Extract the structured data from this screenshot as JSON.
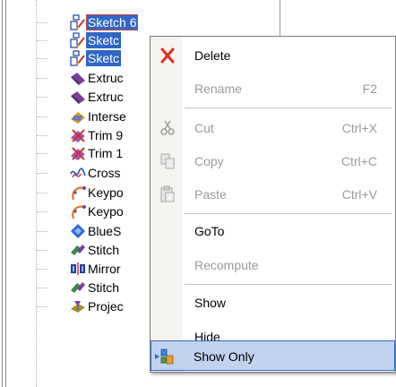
{
  "tree": {
    "items": [
      {
        "label": "Sketch 6",
        "icon": "sketch-icon",
        "selected": true
      },
      {
        "label": "Sketc",
        "icon": "sketch-icon",
        "selected": true
      },
      {
        "label": "Sketc",
        "icon": "sketch-icon",
        "selected": true
      },
      {
        "label": "Extruc",
        "icon": "extrude-icon"
      },
      {
        "label": "Extruc",
        "icon": "extrude-icon"
      },
      {
        "label": "Interse",
        "icon": "intersect-icon"
      },
      {
        "label": "Trim 9",
        "icon": "trim-icon"
      },
      {
        "label": "Trim 1",
        "icon": "trim-icon"
      },
      {
        "label": "Cross",
        "icon": "cross-section-icon"
      },
      {
        "label": "Keypo",
        "icon": "keypoint-curve-icon"
      },
      {
        "label": "Keypo",
        "icon": "keypoint-curve-icon"
      },
      {
        "label": "BlueS",
        "icon": "blue-surface-icon"
      },
      {
        "label": "Stitch",
        "icon": "stitch-icon"
      },
      {
        "label": "Mirror",
        "icon": "mirror-icon"
      },
      {
        "label": "Stitch",
        "icon": "stitch-icon"
      },
      {
        "label": "Projec",
        "icon": "project-icon"
      }
    ]
  },
  "context_menu": {
    "items": [
      {
        "label": "Delete",
        "shortcut": "",
        "icon": "delete-icon",
        "disabled": false
      },
      {
        "label": "Rename",
        "shortcut": "F2",
        "icon": "",
        "disabled": true
      },
      {
        "label": "Cut",
        "shortcut": "Ctrl+X",
        "icon": "cut-icon",
        "disabled": true
      },
      {
        "label": "Copy",
        "shortcut": "Ctrl+C",
        "icon": "copy-icon",
        "disabled": true
      },
      {
        "label": "Paste",
        "shortcut": "Ctrl+V",
        "icon": "paste-icon",
        "disabled": true
      },
      {
        "label": "GoTo",
        "shortcut": "",
        "icon": "",
        "disabled": false
      },
      {
        "label": "Recompute",
        "shortcut": "",
        "icon": "",
        "disabled": true
      },
      {
        "label": "Show",
        "shortcut": "",
        "icon": "",
        "disabled": false
      },
      {
        "label": "Hide",
        "shortcut": "",
        "icon": "",
        "disabled": false
      },
      {
        "label": "Show Only",
        "shortcut": "",
        "icon": "show-only-icon",
        "disabled": false,
        "highlighted": true
      }
    ]
  },
  "colors": {
    "selection": "#3166c4",
    "menu_highlight": "#c1d2ee",
    "disabled_text": "#9a9a9a"
  }
}
